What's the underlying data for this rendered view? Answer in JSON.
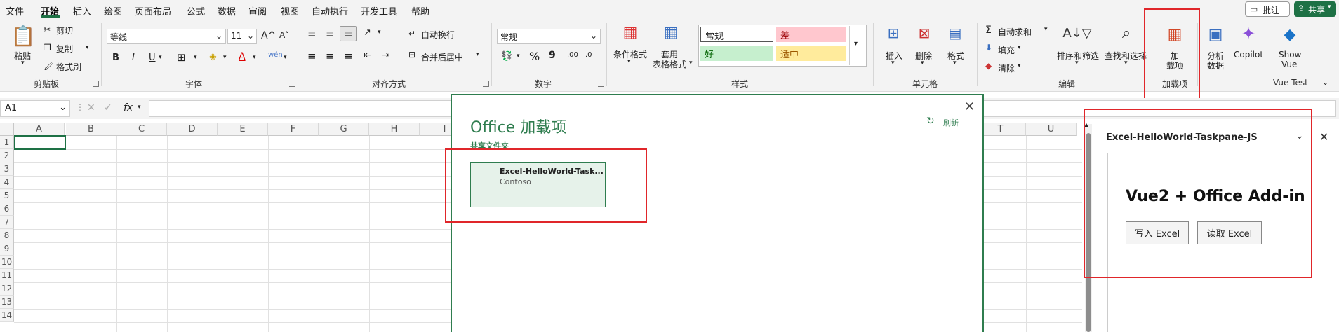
{
  "menu": {
    "tabs": [
      "文件",
      "开始",
      "插入",
      "绘图",
      "页面布局",
      "公式",
      "数据",
      "审阅",
      "视图",
      "自动执行",
      "开发工具",
      "帮助"
    ],
    "comment_label": "批注",
    "share_label": "共享"
  },
  "ribbon": {
    "clipboard": {
      "label": "剪贴板",
      "paste": "粘贴",
      "cut": "剪切",
      "copy": "复制",
      "format_painter": "格式刷"
    },
    "font": {
      "label": "字体",
      "name": "等线",
      "size": "11",
      "bold": "B",
      "italic": "I",
      "underline": "U"
    },
    "alignment": {
      "label": "对齐方式",
      "wrap": "自动换行",
      "merge": "合并后居中"
    },
    "number": {
      "label": "数字",
      "format": "常规",
      "percent": "%",
      "comma": "9"
    },
    "styles": {
      "label": "样式",
      "conditional": "条件格式",
      "table": "套用\n表格格式",
      "normal": "常规",
      "bad": "差",
      "good": "好",
      "neutral": "适中"
    },
    "cells": {
      "label": "单元格",
      "insert": "插入",
      "delete": "删除",
      "format": "格式"
    },
    "editing": {
      "label": "编辑",
      "autosum": "自动求和",
      "fill": "填充",
      "clear": "清除",
      "sort": "排序和筛选",
      "find": "查找和选择"
    },
    "addins": {
      "label": "加载项",
      "addins_btn": "加\n载项",
      "analyze": "分析\n数据",
      "copilot": "Copilot",
      "show_vue": "Show\nVue",
      "vue_group": "Vue Test"
    }
  },
  "formula_bar": {
    "cell_ref": "A1",
    "fx": "fx"
  },
  "columns": [
    "A",
    "B",
    "C",
    "D",
    "E",
    "F",
    "G",
    "H",
    "I",
    "T",
    "U"
  ],
  "rows": [
    "1",
    "2",
    "3",
    "4",
    "5",
    "6",
    "7",
    "8",
    "9",
    "10",
    "11",
    "12",
    "13",
    "14"
  ],
  "dialog": {
    "title": "Office 加载项",
    "refresh": "刷新",
    "section": "共享文件夹",
    "addin_name": "Excel-HelloWorld-Task...",
    "addin_publisher": "Contoso"
  },
  "taskpane": {
    "title": "Excel-HelloWorld-Taskpane-JS",
    "heading": "Vue2 + Office Add-in",
    "write_btn": "写入 Excel",
    "read_btn": "读取 Excel"
  },
  "colors": {
    "accent": "#1e7145",
    "dialog_green": "#2f7d4f",
    "highlight_red": "#e0262a"
  }
}
